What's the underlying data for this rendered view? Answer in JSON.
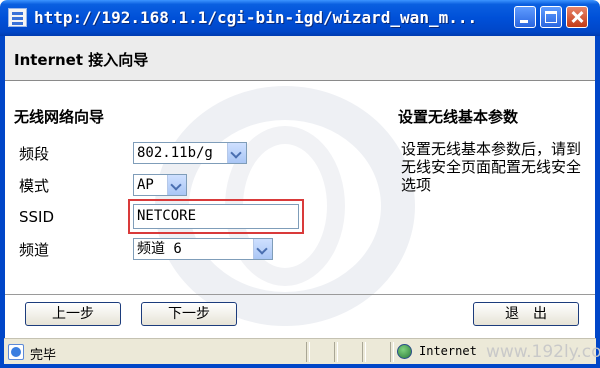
{
  "window": {
    "title": "http://192.168.1.1/cgi-bin-igd/wizard_wan_m..."
  },
  "header": {
    "title": "Internet 接入向导"
  },
  "wizard": {
    "section_title": "无线网络向导",
    "band_label": "频段",
    "band_value": "802.11b/g",
    "mode_label": "模式",
    "mode_value": "AP",
    "ssid_label": "SSID",
    "ssid_value": "NETCORE",
    "channel_label": "频道",
    "channel_value": "频道 6"
  },
  "help": {
    "title": "设置无线基本参数",
    "text": "设置无线基本参数后，请到无线安全页面配置无线安全选项"
  },
  "buttons": {
    "prev": "上一步",
    "next": "下一步",
    "exit": "退　出"
  },
  "statusbar": {
    "status": "完毕",
    "zone": "Internet",
    "watermark": "www.192ly.com"
  },
  "colors": {
    "titlebar": "#0050d8",
    "highlight": "#d93a3a"
  }
}
